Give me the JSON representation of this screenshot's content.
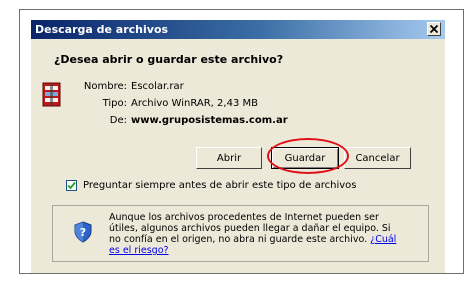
{
  "dialog": {
    "title": "Descarga de archivos",
    "question": "¿Desea abrir o guardar este archivo?",
    "name_label": "Nombre:",
    "name_value": "Escolar.rar",
    "type_label": "Tipo:",
    "type_value": "Archivo WinRAR, 2,43 MB",
    "from_label": "De:",
    "from_value": "www.gruposistemas.com.ar",
    "buttons": {
      "open": "Abrir",
      "save": "Guardar",
      "cancel": "Cancelar"
    },
    "checkbox": {
      "checked": true,
      "label": "Preguntar siempre antes de abrir este tipo de archivos"
    },
    "warning_text": "Aunque los archivos procedentes de Internet pueden ser útiles, algunos archivos pueden llegar a dañar el equipo. Si no confía en el origen, no abra ni guarde este archivo. ",
    "warning_link": "¿Cuál es el riesgo?"
  },
  "colors": {
    "title_gradient_start": "#0a246a",
    "title_gradient_end": "#a6caf0",
    "dialog_bg": "#ece9d8",
    "highlight": "#e0101a",
    "link": "#0000ee"
  },
  "icons": {
    "file": "winrar-file-icon",
    "close": "close-icon",
    "security": "shield-question-icon",
    "check": "check-icon"
  }
}
